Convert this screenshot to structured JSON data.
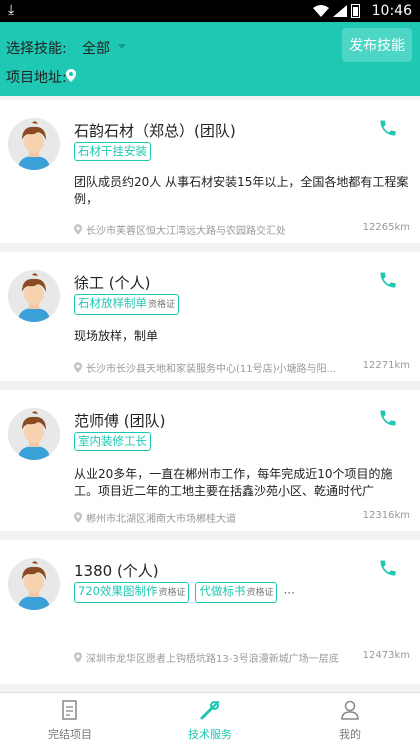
{
  "status_bar": {
    "time": "10:46"
  },
  "header": {
    "skill_label": "选择技能:",
    "skill_value": "全部",
    "publish_button": "发布技能",
    "address_label": "项目地址:"
  },
  "providers": [
    {
      "name": "石韵石材（郑总）(团队)",
      "tags": [
        {
          "label": "石材干挂安装",
          "cert": ""
        }
      ],
      "has_more_tags": false,
      "description": "团队成员约20人 从事石材安装15年以上，全国各地都有工程案例，",
      "location": "长沙市芙蓉区恒大江湾远大路与农园路交汇处",
      "distance": "12265km"
    },
    {
      "name": "徐工 (个人)",
      "tags": [
        {
          "label": "石材放样制单",
          "cert": "资格证"
        }
      ],
      "has_more_tags": false,
      "description": "现场放样，制单",
      "location": "长沙市长沙县天地和家装服务中心(11号店)小塘路与阳...",
      "distance": "12271km"
    },
    {
      "name": "范师傅 (团队)",
      "tags": [
        {
          "label": "室内装修工长",
          "cert": ""
        }
      ],
      "has_more_tags": false,
      "description": "从业20多年，一直在郴州市工作，每年完成近10个项目的施工。项目近二年的工地主要在括鑫沙苑小区、乾通时代广",
      "location": "郴州市北湖区湘南大市场郴桂大道",
      "distance": "12316km"
    },
    {
      "name": "1380 (个人)",
      "tags": [
        {
          "label": "720效果图制作",
          "cert": "资格证"
        },
        {
          "label": "代做标书",
          "cert": "资格证"
        }
      ],
      "has_more_tags": true,
      "more_symbol": "···",
      "description": "",
      "location": "深圳市龙华区愿者上钩梧坑路13-3号浪漫新城广场一层底",
      "distance": "12473km"
    }
  ],
  "tabbar": {
    "items": [
      {
        "label": "完结项目",
        "icon": "document-icon"
      },
      {
        "label": "技术服务",
        "icon": "tools-icon"
      },
      {
        "label": "我的",
        "icon": "person-icon"
      }
    ],
    "active_index": 1
  },
  "colors": {
    "accent": "#1ec8b3",
    "background": "#f2f2f2"
  }
}
